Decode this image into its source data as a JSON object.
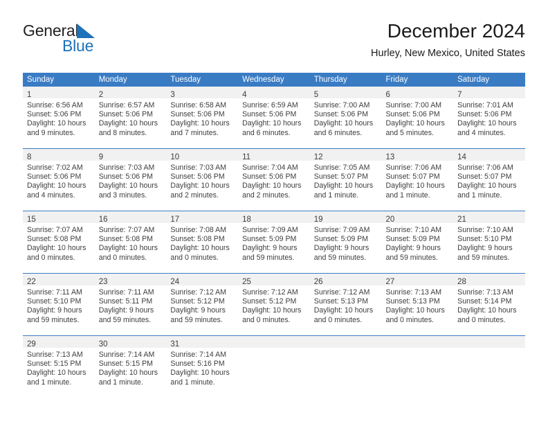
{
  "brand": {
    "name_part1": "General",
    "name_part2": "Blue",
    "accent_color": "#1d71b8"
  },
  "header": {
    "title": "December 2024",
    "subtitle": "Hurley, New Mexico, United States"
  },
  "theme": {
    "header_bar_color": "#3a7cc4",
    "daynum_band_color": "#f1f1f1",
    "text_color": "#3d3d3d"
  },
  "weekdays": [
    "Sunday",
    "Monday",
    "Tuesday",
    "Wednesday",
    "Thursday",
    "Friday",
    "Saturday"
  ],
  "weeks": [
    [
      {
        "day": "1",
        "lines": [
          "Sunrise: 6:56 AM",
          "Sunset: 5:06 PM",
          "Daylight: 10 hours",
          "and 9 minutes."
        ]
      },
      {
        "day": "2",
        "lines": [
          "Sunrise: 6:57 AM",
          "Sunset: 5:06 PM",
          "Daylight: 10 hours",
          "and 8 minutes."
        ]
      },
      {
        "day": "3",
        "lines": [
          "Sunrise: 6:58 AM",
          "Sunset: 5:06 PM",
          "Daylight: 10 hours",
          "and 7 minutes."
        ]
      },
      {
        "day": "4",
        "lines": [
          "Sunrise: 6:59 AM",
          "Sunset: 5:06 PM",
          "Daylight: 10 hours",
          "and 6 minutes."
        ]
      },
      {
        "day": "5",
        "lines": [
          "Sunrise: 7:00 AM",
          "Sunset: 5:06 PM",
          "Daylight: 10 hours",
          "and 6 minutes."
        ]
      },
      {
        "day": "6",
        "lines": [
          "Sunrise: 7:00 AM",
          "Sunset: 5:06 PM",
          "Daylight: 10 hours",
          "and 5 minutes."
        ]
      },
      {
        "day": "7",
        "lines": [
          "Sunrise: 7:01 AM",
          "Sunset: 5:06 PM",
          "Daylight: 10 hours",
          "and 4 minutes."
        ]
      }
    ],
    [
      {
        "day": "8",
        "lines": [
          "Sunrise: 7:02 AM",
          "Sunset: 5:06 PM",
          "Daylight: 10 hours",
          "and 4 minutes."
        ]
      },
      {
        "day": "9",
        "lines": [
          "Sunrise: 7:03 AM",
          "Sunset: 5:06 PM",
          "Daylight: 10 hours",
          "and 3 minutes."
        ]
      },
      {
        "day": "10",
        "lines": [
          "Sunrise: 7:03 AM",
          "Sunset: 5:06 PM",
          "Daylight: 10 hours",
          "and 2 minutes."
        ]
      },
      {
        "day": "11",
        "lines": [
          "Sunrise: 7:04 AM",
          "Sunset: 5:06 PM",
          "Daylight: 10 hours",
          "and 2 minutes."
        ]
      },
      {
        "day": "12",
        "lines": [
          "Sunrise: 7:05 AM",
          "Sunset: 5:07 PM",
          "Daylight: 10 hours",
          "and 1 minute."
        ]
      },
      {
        "day": "13",
        "lines": [
          "Sunrise: 7:06 AM",
          "Sunset: 5:07 PM",
          "Daylight: 10 hours",
          "and 1 minute."
        ]
      },
      {
        "day": "14",
        "lines": [
          "Sunrise: 7:06 AM",
          "Sunset: 5:07 PM",
          "Daylight: 10 hours",
          "and 1 minute."
        ]
      }
    ],
    [
      {
        "day": "15",
        "lines": [
          "Sunrise: 7:07 AM",
          "Sunset: 5:08 PM",
          "Daylight: 10 hours",
          "and 0 minutes."
        ]
      },
      {
        "day": "16",
        "lines": [
          "Sunrise: 7:07 AM",
          "Sunset: 5:08 PM",
          "Daylight: 10 hours",
          "and 0 minutes."
        ]
      },
      {
        "day": "17",
        "lines": [
          "Sunrise: 7:08 AM",
          "Sunset: 5:08 PM",
          "Daylight: 10 hours",
          "and 0 minutes."
        ]
      },
      {
        "day": "18",
        "lines": [
          "Sunrise: 7:09 AM",
          "Sunset: 5:09 PM",
          "Daylight: 9 hours",
          "and 59 minutes."
        ]
      },
      {
        "day": "19",
        "lines": [
          "Sunrise: 7:09 AM",
          "Sunset: 5:09 PM",
          "Daylight: 9 hours",
          "and 59 minutes."
        ]
      },
      {
        "day": "20",
        "lines": [
          "Sunrise: 7:10 AM",
          "Sunset: 5:09 PM",
          "Daylight: 9 hours",
          "and 59 minutes."
        ]
      },
      {
        "day": "21",
        "lines": [
          "Sunrise: 7:10 AM",
          "Sunset: 5:10 PM",
          "Daylight: 9 hours",
          "and 59 minutes."
        ]
      }
    ],
    [
      {
        "day": "22",
        "lines": [
          "Sunrise: 7:11 AM",
          "Sunset: 5:10 PM",
          "Daylight: 9 hours",
          "and 59 minutes."
        ]
      },
      {
        "day": "23",
        "lines": [
          "Sunrise: 7:11 AM",
          "Sunset: 5:11 PM",
          "Daylight: 9 hours",
          "and 59 minutes."
        ]
      },
      {
        "day": "24",
        "lines": [
          "Sunrise: 7:12 AM",
          "Sunset: 5:12 PM",
          "Daylight: 9 hours",
          "and 59 minutes."
        ]
      },
      {
        "day": "25",
        "lines": [
          "Sunrise: 7:12 AM",
          "Sunset: 5:12 PM",
          "Daylight: 10 hours",
          "and 0 minutes."
        ]
      },
      {
        "day": "26",
        "lines": [
          "Sunrise: 7:12 AM",
          "Sunset: 5:13 PM",
          "Daylight: 10 hours",
          "and 0 minutes."
        ]
      },
      {
        "day": "27",
        "lines": [
          "Sunrise: 7:13 AM",
          "Sunset: 5:13 PM",
          "Daylight: 10 hours",
          "and 0 minutes."
        ]
      },
      {
        "day": "28",
        "lines": [
          "Sunrise: 7:13 AM",
          "Sunset: 5:14 PM",
          "Daylight: 10 hours",
          "and 0 minutes."
        ]
      }
    ],
    [
      {
        "day": "29",
        "lines": [
          "Sunrise: 7:13 AM",
          "Sunset: 5:15 PM",
          "Daylight: 10 hours",
          "and 1 minute."
        ]
      },
      {
        "day": "30",
        "lines": [
          "Sunrise: 7:14 AM",
          "Sunset: 5:15 PM",
          "Daylight: 10 hours",
          "and 1 minute."
        ]
      },
      {
        "day": "31",
        "lines": [
          "Sunrise: 7:14 AM",
          "Sunset: 5:16 PM",
          "Daylight: 10 hours",
          "and 1 minute."
        ]
      },
      {
        "day": "",
        "lines": []
      },
      {
        "day": "",
        "lines": []
      },
      {
        "day": "",
        "lines": []
      },
      {
        "day": "",
        "lines": []
      }
    ]
  ]
}
